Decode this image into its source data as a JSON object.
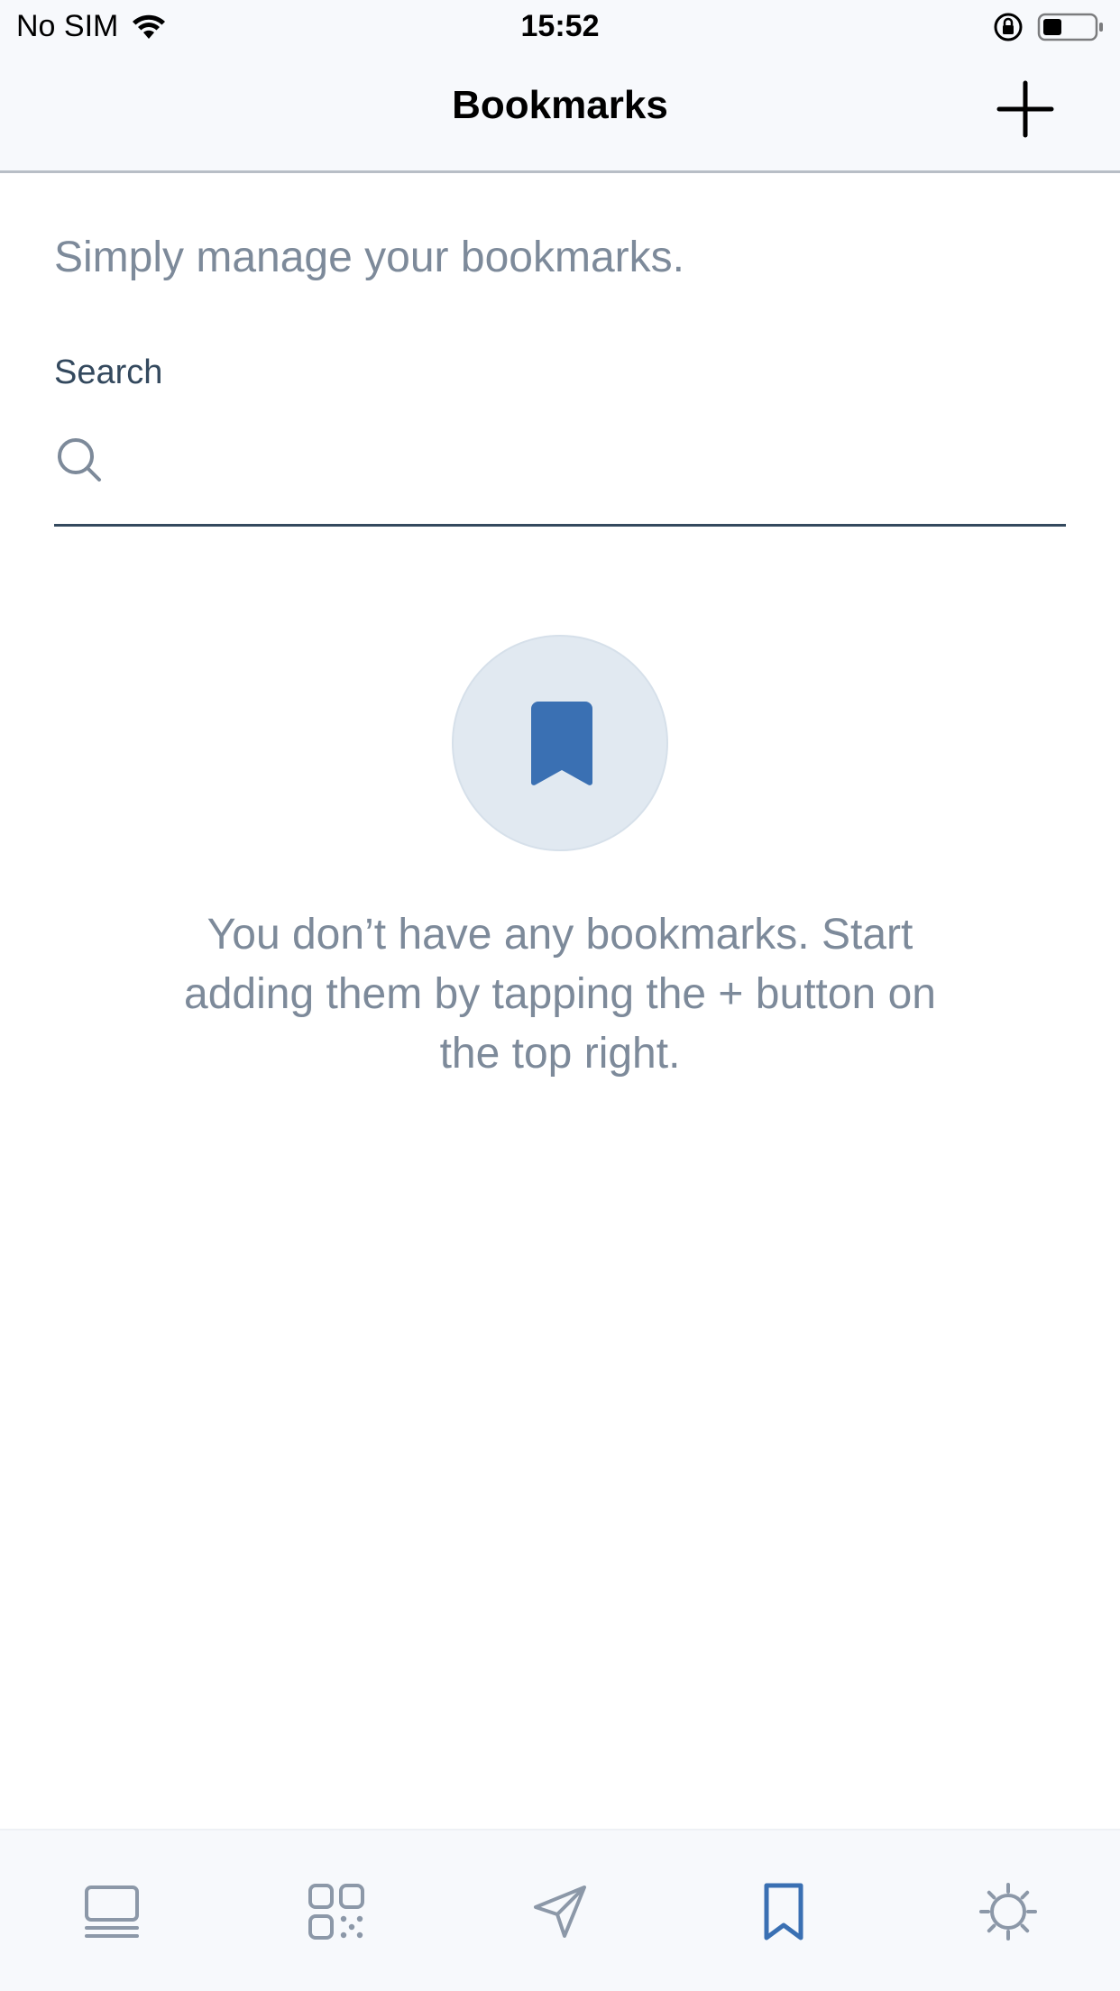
{
  "status_bar": {
    "carrier": "No SIM",
    "time": "15:52",
    "wifi_icon": "wifi-icon",
    "rotation_lock_icon": "rotation-lock-icon",
    "battery_icon": "battery-icon"
  },
  "nav": {
    "title": "Bookmarks",
    "add_icon": "plus-icon"
  },
  "main": {
    "subtitle": "Simply manage your bookmarks.",
    "search": {
      "label": "Search",
      "value": "",
      "placeholder": ""
    },
    "empty_state": {
      "icon": "bookmark-icon",
      "message": "You don’t have any bookmarks. Start adding them by tapping the + button on the top right."
    }
  },
  "tab_bar": {
    "items": [
      {
        "icon": "cards-icon",
        "active": false
      },
      {
        "icon": "qr-code-icon",
        "active": false
      },
      {
        "icon": "send-icon",
        "active": false
      },
      {
        "icon": "bookmark-icon",
        "active": true
      },
      {
        "icon": "settings-icon",
        "active": false
      }
    ]
  },
  "colors": {
    "accent": "#3a70b3",
    "muted_text": "#7d8a9a",
    "dark_text": "#34495e",
    "inactive_icon": "#8c98a8",
    "empty_circle": "#e1e9f1"
  }
}
